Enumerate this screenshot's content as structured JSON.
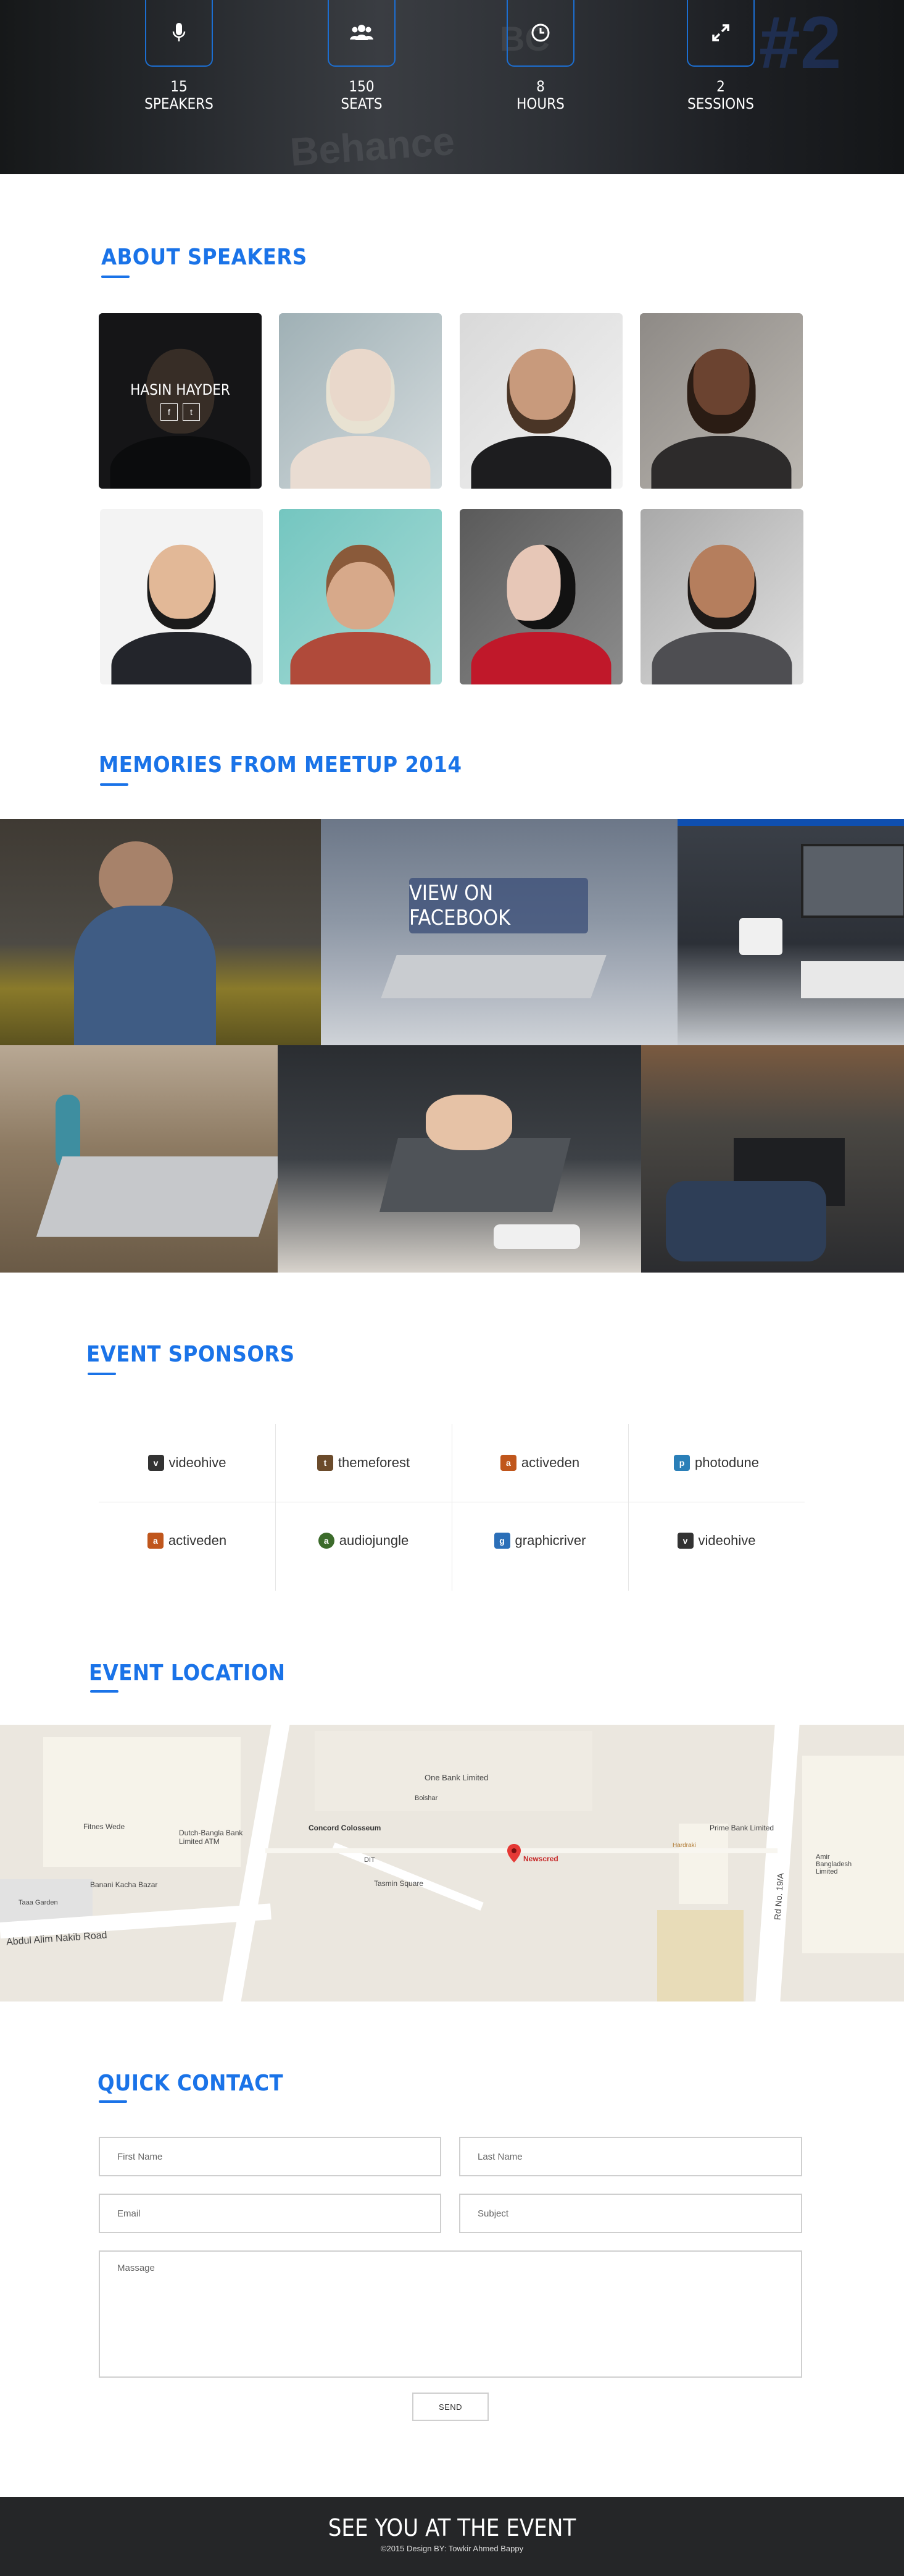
{
  "stats": [
    {
      "icon": "microphone-icon",
      "value": "15",
      "label": "SPEAKERS"
    },
    {
      "icon": "users-icon",
      "value": "150",
      "label": "SEATS"
    },
    {
      "icon": "clock-icon",
      "value": "8",
      "label": "HOURS"
    },
    {
      "icon": "expand-icon",
      "value": "2",
      "label": "SESSIONS"
    }
  ],
  "speakers_section": {
    "title": "ABOUT SPEAKERS",
    "featured": {
      "name": "HASIN HAYDER",
      "social": [
        "f",
        "t"
      ]
    }
  },
  "memories_section": {
    "title": "MEMORIES FROM MEETUP 2014",
    "cta": "VIEW ON FACEBOOK"
  },
  "sponsors_section": {
    "title": "EVENT SPONSORS",
    "sponsors": [
      {
        "name": "videohive",
        "color": "#333333"
      },
      {
        "name": "themeforest",
        "color": "#6b4b2b"
      },
      {
        "name": "activeden",
        "color": "#c0561c"
      },
      {
        "name": "photodune",
        "color": "#2a7fb8"
      },
      {
        "name": "activeden",
        "color": "#c0561c"
      },
      {
        "name": "audiojungle",
        "color": "#3c6b2b"
      },
      {
        "name": "graphicriver",
        "color": "#2b6fb8"
      },
      {
        "name": "videohive",
        "color": "#333333"
      }
    ]
  },
  "location_section": {
    "title": "EVENT LOCATION",
    "map": {
      "labels": [
        "One Bank Limited",
        "Boishar",
        "Concord Colosseum",
        "DIT",
        "Newscred",
        "Tasmin Square",
        "Prime Bank Limited",
        "Dutch-Bangla Bank Limited ATM",
        "Fitnes Wede",
        "Banani Kacha Bazar",
        "Taaa Garden",
        "Abdul Alim Nakib Road",
        "Rd No. 19/A",
        "Amir Bangladesh Limited",
        "Hardraki"
      ]
    }
  },
  "contact_section": {
    "title": "QUICK CONTACT",
    "first_name_placeholder": "First Name",
    "last_name_placeholder": "Last Name",
    "email_placeholder": "Email",
    "subject_placeholder": "Subject",
    "message_placeholder": "Massage",
    "send_label": "SEND"
  },
  "footer": {
    "title": "SEE YOU AT THE EVENT",
    "copyright": "©2015  Design BY: Towkir Ahmed Bappy"
  },
  "colors": {
    "accent": "#1a73e8",
    "footer_bg": "#252628"
  }
}
